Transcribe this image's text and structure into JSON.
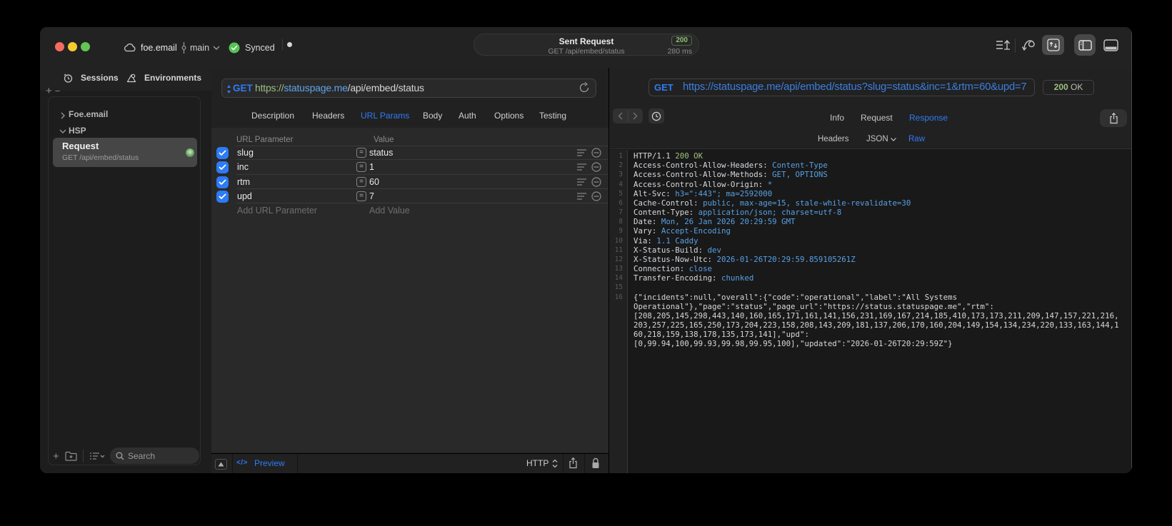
{
  "titlebar": {
    "project": "foe.email",
    "branch": "main",
    "sync_status": "Synced",
    "request_pill": {
      "title": "Sent Request",
      "status_code": "200",
      "subtitle": "GET /api/embed/status",
      "duration": "280 ms"
    }
  },
  "sidebar": {
    "tabs": [
      {
        "label": "Sessions",
        "icon": "clock"
      },
      {
        "label": "Environments",
        "icon": "environments"
      }
    ],
    "tree": [
      {
        "label": "Foe.email",
        "expanded": false
      },
      {
        "label": "HSP",
        "expanded": true
      }
    ],
    "request_item": {
      "title": "Request",
      "subtitle": "GET /api/embed/status",
      "status": "success"
    },
    "search_placeholder": "Search"
  },
  "editor": {
    "method": "GET",
    "url": {
      "scheme": "https://",
      "host": "statuspage.me",
      "path": "/api/embed/status"
    },
    "tabs": [
      "Description",
      "Headers",
      "URL Params",
      "Body",
      "Auth",
      "Options",
      "Testing"
    ],
    "active_tab": "URL Params",
    "table": {
      "columns": [
        "URL Parameter",
        "Value"
      ],
      "rows": [
        {
          "checked": true,
          "key": "slug",
          "value": "status"
        },
        {
          "checked": true,
          "key": "inc",
          "value": "1"
        },
        {
          "checked": true,
          "key": "rtm",
          "value": "60"
        },
        {
          "checked": true,
          "key": "upd",
          "value": "7"
        }
      ],
      "add_key_label": "Add URL Parameter",
      "add_value_label": "Add Value"
    },
    "footer": {
      "code_glyph": "</>",
      "preview_label": "Preview",
      "protocol": "HTTP"
    }
  },
  "response": {
    "method": "GET",
    "url": "https://statuspage.me/api/embed/status?slug=status&inc=1&rtm=60&upd=7",
    "status_code": "200",
    "status_text": "OK",
    "tabs": [
      "Info",
      "Request",
      "Response"
    ],
    "active_tab": "Response",
    "subtabs": [
      "Headers",
      "JSON",
      "Raw"
    ],
    "active_subtab": "Raw",
    "status_line": {
      "prefix": "HTTP/1.1 ",
      "status": "200 OK"
    },
    "headers": [
      {
        "name": "Access-Control-Allow-Headers",
        "value": "Content-Type"
      },
      {
        "name": "Access-Control-Allow-Methods",
        "value": "GET, OPTIONS"
      },
      {
        "name": "Access-Control-Allow-Origin",
        "value": "*"
      },
      {
        "name": "Alt-Svc",
        "value": "h3=\":443\"; ma=2592000"
      },
      {
        "name": "Cache-Control",
        "value": "public, max-age=15, stale-while-revalidate=30"
      },
      {
        "name": "Content-Type",
        "value": "application/json; charset=utf-8"
      },
      {
        "name": "Date",
        "value": "Mon, 26 Jan 2026 20:29:59 GMT"
      },
      {
        "name": "Vary",
        "value": "Accept-Encoding"
      },
      {
        "name": "Via",
        "value": "1.1 Caddy"
      },
      {
        "name": "X-Status-Build",
        "value": "dev"
      },
      {
        "name": "X-Status-Now-Utc",
        "value": "2026-01-26T20:29:59.859105261Z"
      },
      {
        "name": "Connection",
        "value": "close"
      },
      {
        "name": "Transfer-Encoding",
        "value": "chunked"
      }
    ],
    "body_lines": [
      "{\"incidents\":null,\"overall\":{\"code\":\"operational\",\"label\":\"All Systems",
      "Operational\"},\"page\":\"status\",\"page_url\":\"https://status.statuspage.me\",\"rtm\":",
      "[208,205,145,298,443,140,160,165,171,161,141,156,231,169,167,214,185,410,173,173,211,209,147,157,221,216,",
      "203,257,225,165,250,173,204,223,158,208,143,209,181,137,206,170,160,204,149,154,134,234,220,133,163,144,1",
      "60,218,159,138,178,135,173,141],\"upd\":",
      "[0,99.94,100,99.93,99.98,99.95,100],\"updated\":\"2026-01-26T20:29:59Z\"}"
    ]
  }
}
